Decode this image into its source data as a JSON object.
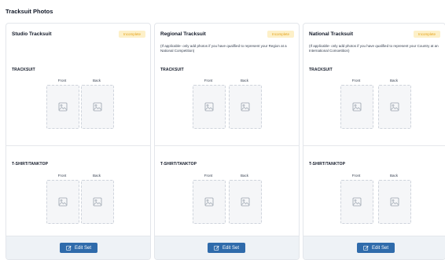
{
  "page": {
    "title": "Tracksuit Photos"
  },
  "cards": [
    {
      "title": "Studio Tracksuit",
      "status": "Incomplete",
      "note": "",
      "sections": [
        {
          "label": "TRACKSUIT",
          "photos": [
            "Front",
            "Back"
          ]
        },
        {
          "label": "T-SHIRT/TANKTOP",
          "photos": [
            "Front",
            "Back"
          ]
        }
      ],
      "button": "Edit Set"
    },
    {
      "title": "Regional Tracksuit",
      "status": "Incomplete",
      "note": "(If applicable- only add photos if you have qualified to represent your Region at a National Competition)",
      "sections": [
        {
          "label": "TRACKSUIT",
          "photos": [
            "Front",
            "Back"
          ]
        },
        {
          "label": "T-SHIRT/TANKTOP",
          "photos": [
            "Front",
            "Back"
          ]
        }
      ],
      "button": "Edit Set"
    },
    {
      "title": "National Tracksuit",
      "status": "Incomplete",
      "note": "(If applicable- only add photos if you have qualified to represent your Country at an International Comoetition)",
      "sections": [
        {
          "label": "TRACKSUIT",
          "photos": [
            "Front",
            "Back"
          ]
        },
        {
          "label": "T-SHIRT/TANKTOP",
          "photos": [
            "Front",
            "Back"
          ]
        }
      ],
      "button": "Edit Set"
    }
  ],
  "icons": {
    "placeholder": "image-placeholder-icon",
    "edit": "edit-icon"
  },
  "colors": {
    "accent": "#2f6bab",
    "badge_bg": "#fdf0c8",
    "badge_text": "#e5a21a",
    "footer_bg": "#eef2f6"
  }
}
